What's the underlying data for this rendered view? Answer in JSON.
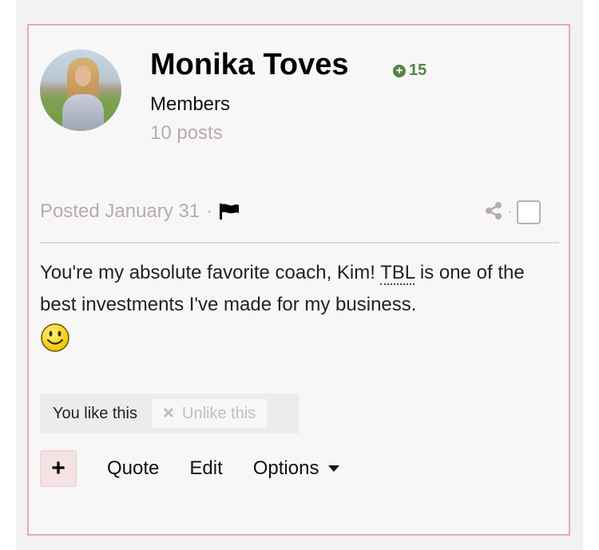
{
  "author": {
    "name": "Monika Toves",
    "reputation": "15",
    "group": "Members",
    "post_count": "10 posts",
    "avatar_icon": "profile-photo"
  },
  "meta": {
    "posted": "Posted January 31",
    "separator": "·",
    "share_separator": "·"
  },
  "content": {
    "text_before": "You're my absolute favorite coach, Kim! ",
    "abbr": "TBL",
    "text_after": " is one of the best investments I've made for my business.",
    "emoji": "smiley-icon"
  },
  "reactions": {
    "status": "You like this",
    "unlike_label": "Unlike this"
  },
  "controls": {
    "plus_label": "+",
    "quote_label": "Quote",
    "edit_label": "Edit",
    "options_label": "Options"
  },
  "colors": {
    "border": "#e8a7bd",
    "muted_text": "#b9a8b6",
    "reputation": "#57834a"
  }
}
